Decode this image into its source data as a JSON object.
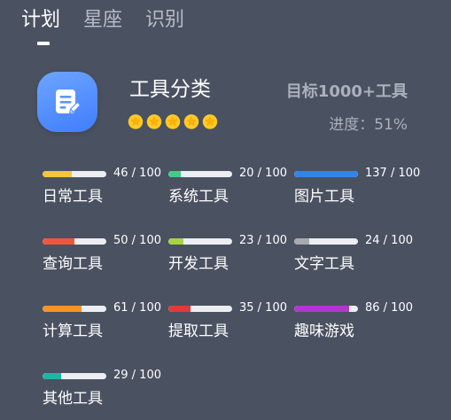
{
  "tabs": [
    {
      "label": "计划",
      "active": true
    },
    {
      "label": "星座",
      "active": false
    },
    {
      "label": "识别",
      "active": false
    }
  ],
  "card": {
    "icon": "note-edit-icon",
    "title": "工具分类",
    "stars": 5,
    "goal": "目标1000+工具",
    "progress_label": "进度：51%",
    "progress_value": 51
  },
  "categories": [
    {
      "name": "日常工具",
      "value": 46,
      "max": 100,
      "count_text": "46 / 100",
      "color": "#f5c53a"
    },
    {
      "name": "系统工具",
      "value": 20,
      "max": 100,
      "count_text": "20 / 100",
      "color": "#3ecf86"
    },
    {
      "name": "图片工具",
      "value": 137,
      "max": 100,
      "count_text": "137 / 100",
      "color": "#2f86e8"
    },
    {
      "name": "查询工具",
      "value": 50,
      "max": 100,
      "count_text": "50 / 100",
      "color": "#f0573a"
    },
    {
      "name": "开发工具",
      "value": 23,
      "max": 100,
      "count_text": "23 / 100",
      "color": "#a6d43e"
    },
    {
      "name": "文字工具",
      "value": 24,
      "max": 100,
      "count_text": "24 / 100",
      "color": "#a7aab0"
    },
    {
      "name": "计算工具",
      "value": 61,
      "max": 100,
      "count_text": "61 / 100",
      "color": "#f59426"
    },
    {
      "name": "提取工具",
      "value": 35,
      "max": 100,
      "count_text": "35 / 100",
      "color": "#e53935"
    },
    {
      "name": "趣味游戏",
      "value": 86,
      "max": 100,
      "count_text": "86 / 100",
      "color": "#b236d1"
    },
    {
      "name": "其他工具",
      "value": 29,
      "max": 100,
      "count_text": "29 / 100",
      "color": "#1fb5a3"
    }
  ]
}
